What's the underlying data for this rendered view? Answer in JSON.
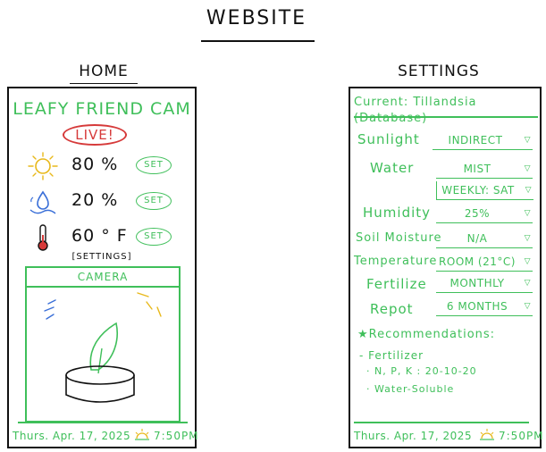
{
  "page_title": "WEBSITE",
  "home": {
    "label": "HOME",
    "title": "LEAFY FRIEND CAM",
    "live_badge": "LIVE!",
    "stats": [
      {
        "icon": "sun-icon",
        "value": "80 %",
        "button": "SET"
      },
      {
        "icon": "water-drop-icon",
        "value": "20 %",
        "button": "SET"
      },
      {
        "icon": "thermometer-icon",
        "value": "60 ° F",
        "button": "SET"
      }
    ],
    "settings_link": "[SETTINGS]",
    "camera_header": "CAMERA",
    "footer": {
      "date": "Thurs. Apr. 17, 2025",
      "time": "7:50PM"
    }
  },
  "settings": {
    "label": "SETTINGS",
    "current": "Current: Tillandsia (Database)",
    "fields": [
      {
        "label": "Sunlight",
        "value": "INDIRECT"
      },
      {
        "label": "Water",
        "value": "MIST"
      },
      {
        "label": "",
        "value": "WEEKLY: SAT"
      },
      {
        "label": "Humidity",
        "value": "25%"
      },
      {
        "label": "Soil Moisture",
        "value": "N/A"
      },
      {
        "label": "Temperature",
        "value": "ROOM (21°C)"
      },
      {
        "label": "Fertilize",
        "value": "MONTHLY"
      },
      {
        "label": "Repot",
        "value": "6 MONTHS"
      }
    ],
    "recommendations_title": "★Recommendations:",
    "rec_item": "- Fertilizer",
    "rec_sub1": "· N, P, K : 20-10-20",
    "rec_sub2": "· Water-Soluble",
    "footer": {
      "date": "Thurs. Apr. 17, 2025",
      "time": "7:50PM"
    }
  },
  "colors": {
    "green": "#3fbf5a",
    "red": "#d63a3a",
    "ink": "#111111"
  }
}
